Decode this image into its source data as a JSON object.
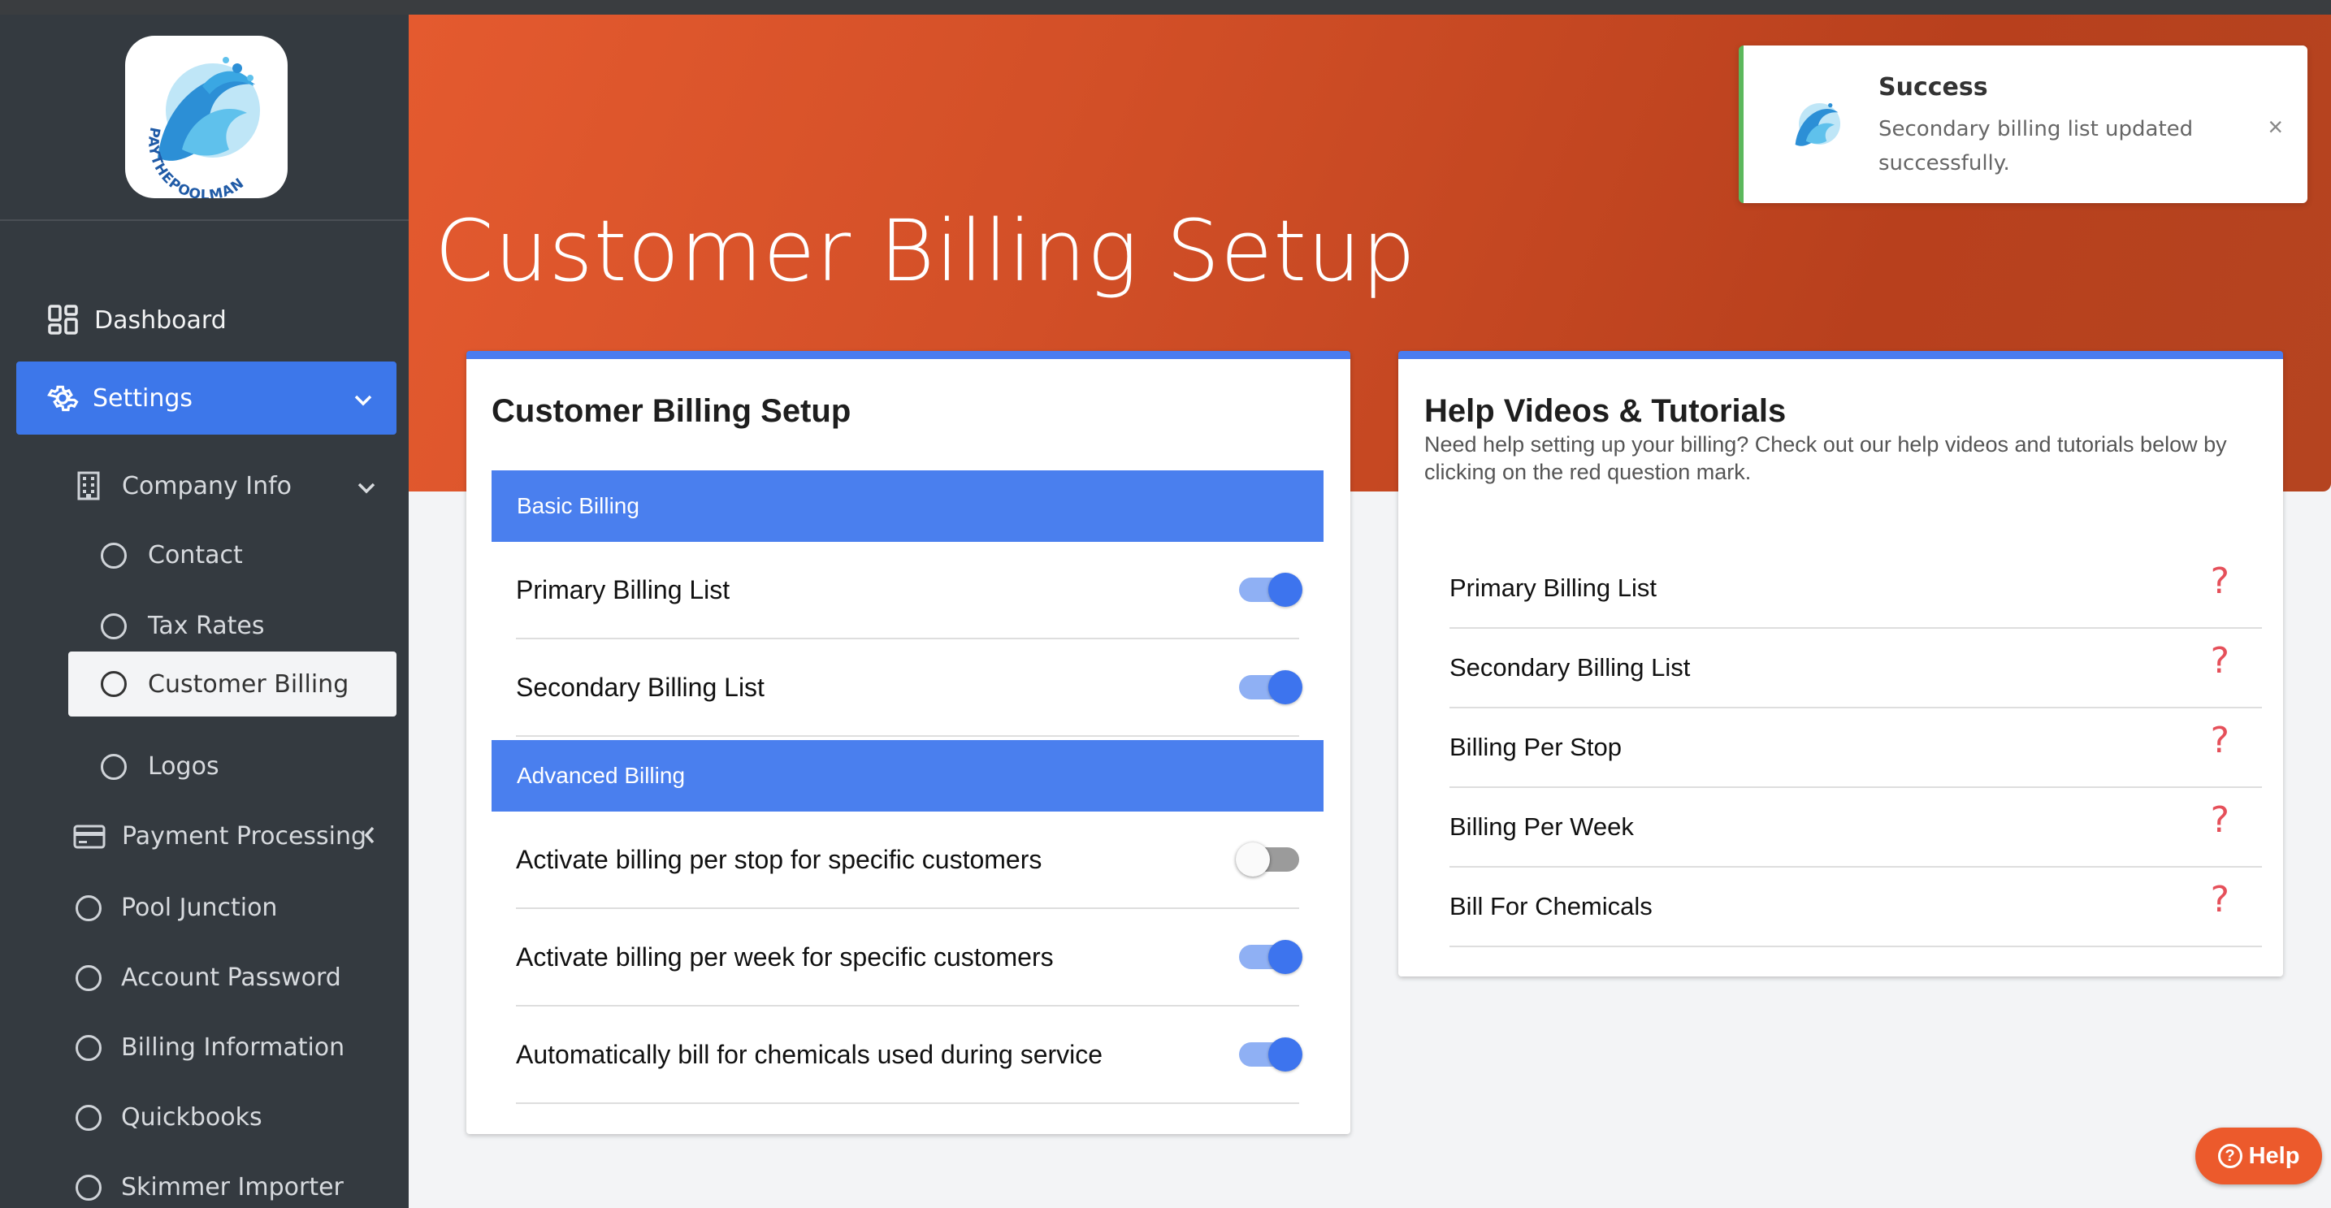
{
  "page": {
    "title": "Customer Billing Setup"
  },
  "sidebar": {
    "logo_text": "PAYTHEPOOLMAN",
    "items": {
      "dashboard": "Dashboard",
      "settings": "Settings",
      "company_info": "Company Info",
      "contact": "Contact",
      "tax_rates": "Tax Rates",
      "customer_billing": "Customer Billing",
      "logos": "Logos",
      "payment_processing": "Payment Processing",
      "pool_junction": "Pool Junction",
      "account_password": "Account Password",
      "billing_information": "Billing Information",
      "quickbooks": "Quickbooks",
      "skimmer_importer": "Skimmer Importer"
    }
  },
  "billing_card": {
    "title": "Customer Billing Setup",
    "basic_section": "Basic Billing",
    "advanced_section": "Advanced Billing",
    "rows": [
      {
        "label": "Primary Billing List",
        "enabled": true
      },
      {
        "label": "Secondary Billing List",
        "enabled": true
      },
      {
        "label": "Activate billing per stop for specific customers",
        "enabled": false
      },
      {
        "label": "Activate billing per week for specific customers",
        "enabled": true
      },
      {
        "label": "Automatically bill for chemicals used during service",
        "enabled": true
      }
    ]
  },
  "help_card": {
    "title": "Help Videos & Tutorials",
    "subtitle": "Need help setting up your billing? Check out our help videos and tutorials below by clicking on the red question mark.",
    "items": [
      "Primary Billing List",
      "Secondary Billing List",
      "Billing Per Stop",
      "Billing Per Week",
      "Bill For Chemicals"
    ],
    "question_glyph": "?"
  },
  "toast": {
    "title": "Success",
    "message": "Secondary billing list updated successfully.",
    "close_glyph": "×"
  },
  "help_button": {
    "label": "Help",
    "icon_glyph": "?"
  },
  "colors": {
    "accent_blue": "#4a7fee",
    "hero_orange": "#e45a2f",
    "sidebar_bg": "#343a40",
    "success_green": "#5cb85c",
    "help_red": "#e5505a"
  }
}
